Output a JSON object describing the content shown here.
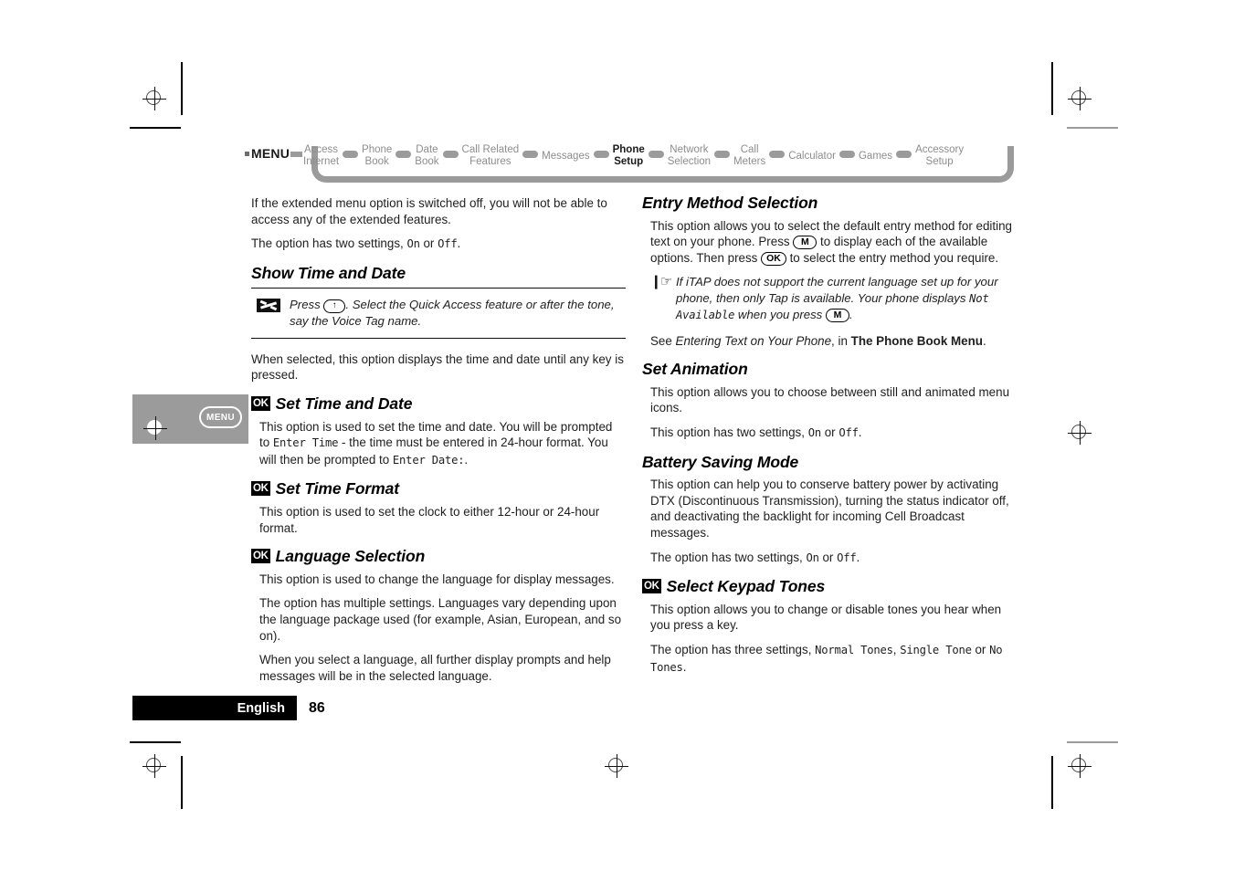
{
  "nav": {
    "menu_label": "MENU",
    "items": [
      {
        "label": "Access\nInternet",
        "active": false
      },
      {
        "label": "Phone\nBook",
        "active": false
      },
      {
        "label": "Date\nBook",
        "active": false
      },
      {
        "label": "Call Related\nFeatures",
        "active": false
      },
      {
        "label": "Messages",
        "active": false
      },
      {
        "label": "Phone\nSetup",
        "active": true
      },
      {
        "label": "Network\nSelection",
        "active": false
      },
      {
        "label": "Call\nMeters",
        "active": false
      },
      {
        "label": "Calculator",
        "active": false
      },
      {
        "label": "Games",
        "active": false
      },
      {
        "label": "Accessory\nSetup",
        "active": false
      }
    ]
  },
  "side_tab": {
    "menu_label": "MENU"
  },
  "left_column": {
    "intro_p1": "If the extended menu option is switched off, you will not be able to access any of the extended features.",
    "intro_p2_a": "The option has two settings, ",
    "intro_p2_on": "On",
    "intro_p2_mid": " or ",
    "intro_p2_off": "Off",
    "intro_p2_end": ".",
    "show_time_date": {
      "heading": "Show Time and Date",
      "note_a": "Press ",
      "note_key": "↑",
      "note_b": ". Select the Quick Access feature or after the tone, say the Voice Tag name.",
      "body": "When selected, this option displays the time and date until any key is pressed."
    },
    "set_time_date": {
      "badge": "OK",
      "heading": "Set Time and Date",
      "body_a": "This option is used to set the time and date. You will be prompted to ",
      "body_lcd1": "Enter Time",
      "body_b": " - the time must be entered in 24-hour format. You will then be prompted to ",
      "body_lcd2": "Enter Date:",
      "body_c": "."
    },
    "set_time_format": {
      "badge": "OK",
      "heading": "Set Time Format",
      "body": "This option is used to set the clock to either 12-hour or 24-hour format."
    },
    "language_selection": {
      "badge": "OK",
      "heading": "Language Selection",
      "body1": "This option is used to change the language for display messages.",
      "body2": "The option has multiple settings. Languages vary depending upon the language package used (for example, Asian, European, and so on).",
      "body3": "When you select a language, all further display prompts and help messages will be in the selected language."
    }
  },
  "right_column": {
    "entry_method": {
      "heading": "Entry Method Selection",
      "body_a": "This option allows you to select the default entry method for editing text on your phone. Press ",
      "key_m": "M",
      "body_b": " to display each of the available options. Then press ",
      "key_ok": "OK",
      "body_c": " to select the entry method you require.",
      "note_a": "If iTAP does not support the current language set up for your phone, then only Tap is available. Your phone displays ",
      "note_lcd": "Not Available",
      "note_b": " when you press ",
      "note_key": "M",
      "note_c": ".",
      "see_a": "See ",
      "see_italic": "Entering Text on Your Phone",
      "see_b": ", in ",
      "see_bold": "The Phone Book Menu",
      "see_c": "."
    },
    "set_animation": {
      "heading": "Set Animation",
      "body1": "This option allows you to choose between still and animated menu icons.",
      "body2_a": "This option has two settings, ",
      "body2_on": "On",
      "body2_mid": " or ",
      "body2_off": "Off",
      "body2_end": "."
    },
    "battery_saving": {
      "heading": "Battery Saving Mode",
      "body1": "This option can help you to conserve battery power by activating DTX (Discontinuous Transmission), turning the status indicator off, and deactivating the backlight for incoming Cell Broadcast messages.",
      "body2_a": "The option has two settings, ",
      "body2_on": "On",
      "body2_mid": " or ",
      "body2_off": "Off",
      "body2_end": "."
    },
    "keypad_tones": {
      "badge": "OK",
      "heading": "Select Keypad Tones",
      "body1": "This option allows you to change or disable tones you hear when you press a key.",
      "body2_a": "The option has three settings, ",
      "body2_lcd1": "Normal Tones",
      "body2_mid1": ", ",
      "body2_lcd2": "Single Tone",
      "body2_mid2": " or ",
      "body2_lcd3": "No Tones",
      "body2_end": "."
    }
  },
  "footer": {
    "language": "English",
    "page_number": "86"
  },
  "colors": {
    "nav_gray": "#9b9b9b",
    "nav_text_inactive": "#8d8d8d",
    "accent_black": "#000000",
    "side_tab_gray": "#9b9b9b"
  }
}
